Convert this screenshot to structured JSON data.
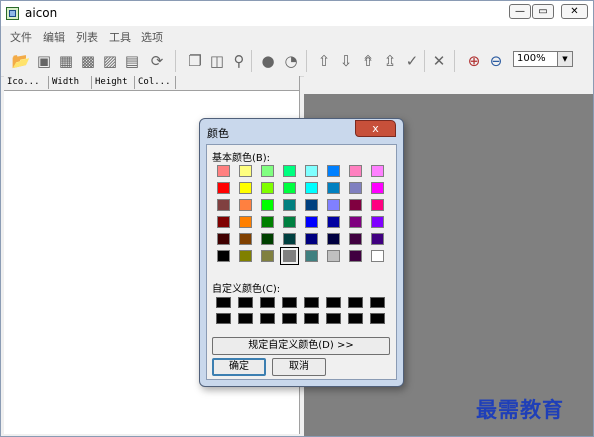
{
  "window": {
    "title": "aicon",
    "minimize_glyph": "—",
    "restore_glyph": "▭",
    "close_glyph": "✕"
  },
  "menu": [
    "文件",
    "编辑",
    "列表",
    "工具",
    "选项"
  ],
  "toolbar": {
    "icons": [
      "open-folder-icon",
      "save-icon",
      "save-as-icon",
      "export-icon",
      "extract-icon",
      "refresh-icon",
      "copy-icon",
      "paste-icon",
      "find-icon",
      "user-icon",
      "user-alt-icon",
      "arrow-up-icon",
      "arrow-down-icon",
      "arrow-top-icon",
      "arrow-bottom-icon",
      "check-icon",
      "delete-icon",
      "zoom-in-icon",
      "zoom-out-icon"
    ],
    "zoom_value": "100%"
  },
  "list": {
    "columns": [
      "Ico...",
      "Width",
      "Height",
      "Col..."
    ]
  },
  "dialog": {
    "title": "颜色",
    "close_glyph": "x",
    "basic_label": "基本颜色(B):",
    "custom_label": "自定义颜色(C):",
    "define_button": "规定自定义颜色(D) >>",
    "ok_button": "确定",
    "cancel_button": "取消",
    "basic_colors": [
      [
        "#ff8080",
        "#ffff80",
        "#80ff80",
        "#00ff80",
        "#80ffff",
        "#0080ff",
        "#ff80c0",
        "#ff80ff"
      ],
      [
        "#ff0000",
        "#ffff00",
        "#80ff00",
        "#00ff40",
        "#00ffff",
        "#0080c0",
        "#8080c0",
        "#ff00ff"
      ],
      [
        "#804040",
        "#ff8040",
        "#00ff00",
        "#008080",
        "#004080",
        "#8080ff",
        "#800040",
        "#ff0080"
      ],
      [
        "#800000",
        "#ff8000",
        "#008000",
        "#008040",
        "#0000ff",
        "#0000a0",
        "#800080",
        "#8000ff"
      ],
      [
        "#400000",
        "#804000",
        "#004000",
        "#004040",
        "#000080",
        "#000040",
        "#400040",
        "#400080"
      ],
      [
        "#000000",
        "#808000",
        "#808040",
        "#808080",
        "#408080",
        "#c0c0c0",
        "#400040",
        "#ffffff"
      ]
    ],
    "selected_color": "#808080"
  },
  "watermark": "最需教育"
}
